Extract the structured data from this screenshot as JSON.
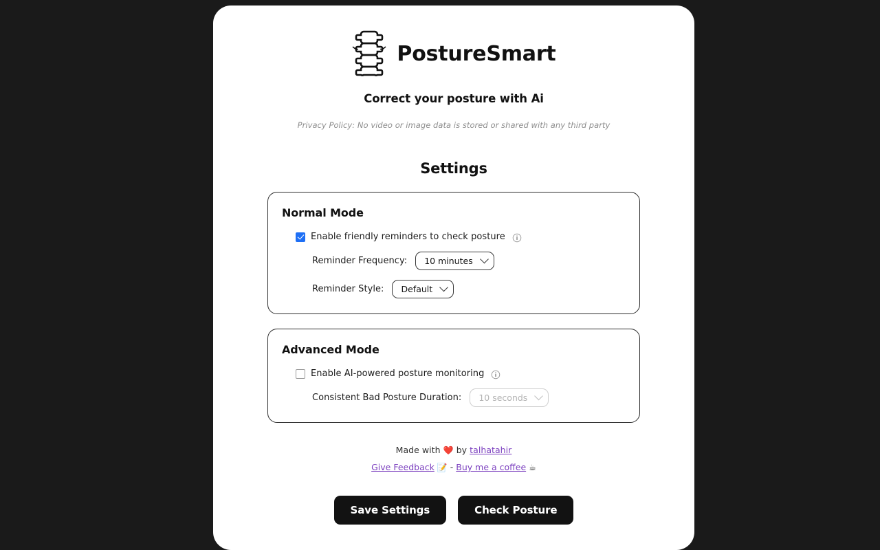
{
  "app": {
    "brand_name": "PostureSmart",
    "logo_icon": "spine-icon",
    "tagline": "Correct your posture with Ai",
    "privacy_note": "Privacy Policy: No video or image data is stored or shared with any third party",
    "background_color": "#1a1a1a",
    "card_color": "#ffffff",
    "accent_color": "#1e6ff5",
    "link_color": "#7b3fbf",
    "button_color": "#121212"
  },
  "settings": {
    "title": "Settings",
    "normal_mode": {
      "title": "Normal Mode",
      "enable_label": "Enable friendly reminders to check posture",
      "enable_checked": true,
      "info_icon": "info-circle-icon",
      "frequency_label": "Reminder Frequency:",
      "frequency_value": "10 minutes",
      "style_label": "Reminder Style:",
      "style_value": "Default"
    },
    "advanced_mode": {
      "title": "Advanced Mode",
      "enable_label": "Enable AI-powered posture monitoring",
      "enable_checked": false,
      "info_icon": "info-circle-icon",
      "duration_label": "Consistent Bad Posture Duration:",
      "duration_value": "10 seconds",
      "duration_disabled": true
    }
  },
  "footer": {
    "made_prefix": "Made with",
    "heart_emoji": "❤️",
    "made_by": "by",
    "author": "talhatahir",
    "feedback_link": "Give Feedback",
    "feedback_emoji": "📝",
    "separator": "-",
    "coffee_link": "Buy me a coffee",
    "coffee_emoji": "☕"
  },
  "actions": {
    "save_label": "Save Settings",
    "check_label": "Check Posture"
  }
}
